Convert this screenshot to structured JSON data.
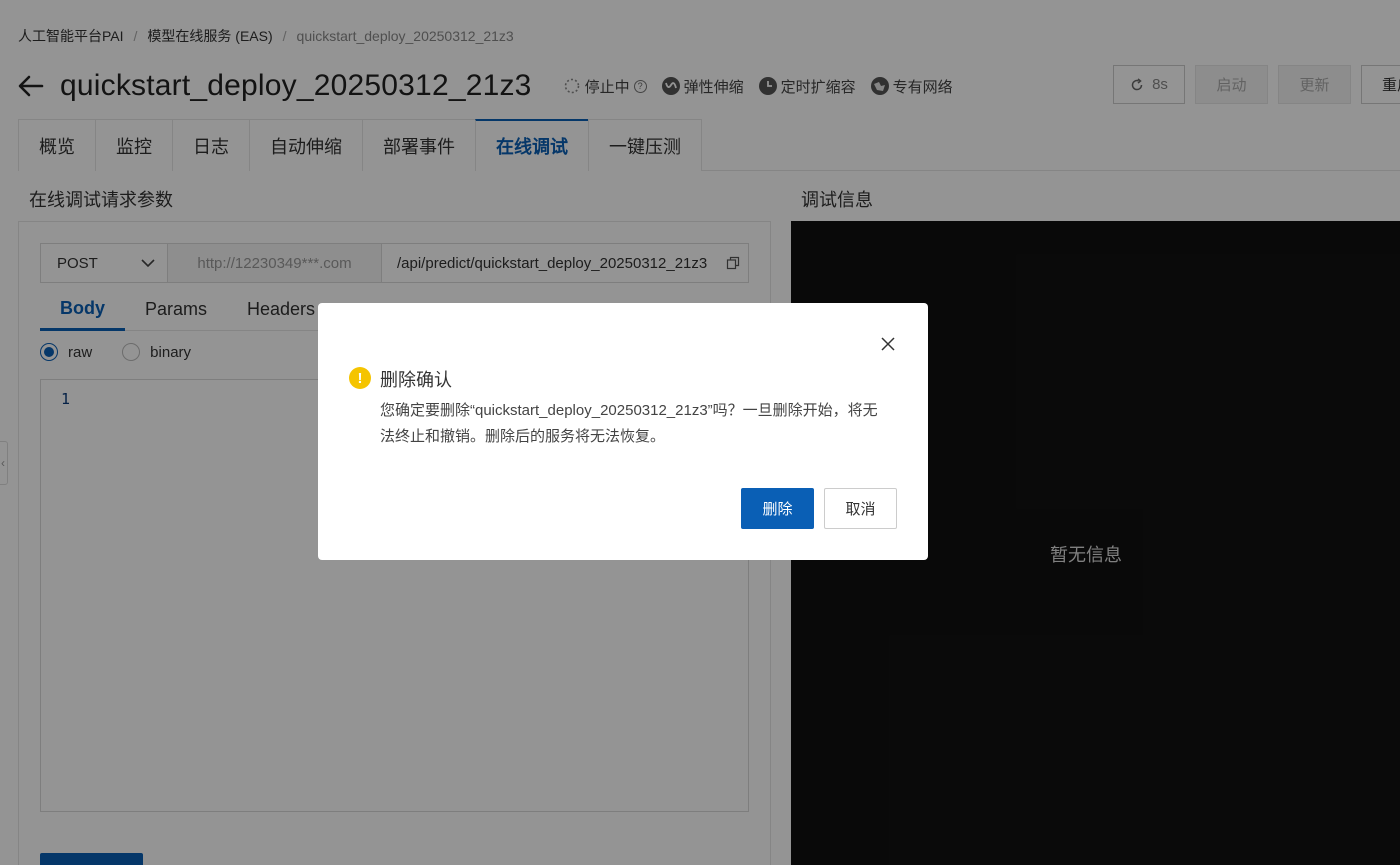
{
  "breadcrumb": {
    "items": [
      "人工智能平台PAI",
      "模型在线服务 (EAS)",
      "quickstart_deploy_20250312_21z3"
    ]
  },
  "header": {
    "title": "quickstart_deploy_20250312_21z3",
    "status": "停止中",
    "elastic_label": "弹性伸缩",
    "scheduled_label": "定时扩缩容",
    "vpc_label": "专有网络",
    "refresh_label": "8s",
    "start_label": "启动",
    "update_label": "更新",
    "restart_label": "重启"
  },
  "tabs": [
    {
      "label": "概览"
    },
    {
      "label": "监控"
    },
    {
      "label": "日志"
    },
    {
      "label": "自动伸缩"
    },
    {
      "label": "部署事件"
    },
    {
      "label": "在线调试",
      "active": true
    },
    {
      "label": "一键压测"
    }
  ],
  "request_panel": {
    "title": "在线调试请求参数",
    "method": "POST",
    "host": "http://12230349***.com",
    "path": "/api/predict/quickstart_deploy_20250312_21z3",
    "subtabs": [
      {
        "label": "Body",
        "active": true
      },
      {
        "label": "Params"
      },
      {
        "label": "Headers"
      }
    ],
    "body_type": {
      "raw_label": "raw",
      "binary_label": "binary",
      "selected": "raw"
    },
    "editor_line": "1"
  },
  "debug_panel": {
    "title": "调试信息",
    "empty_text": "暂无信息"
  },
  "dialog": {
    "title": "删除确认",
    "message": "您确定要删除“quickstart_deploy_20250312_21z3”吗？一旦删除开始，将无法终止和撤销。删除后的服务将无法恢复。",
    "confirm_label": "删除",
    "cancel_label": "取消"
  },
  "colors": {
    "primary": "#0a5fb5",
    "warning": "#f5c400",
    "debug_bg": "#111111"
  }
}
